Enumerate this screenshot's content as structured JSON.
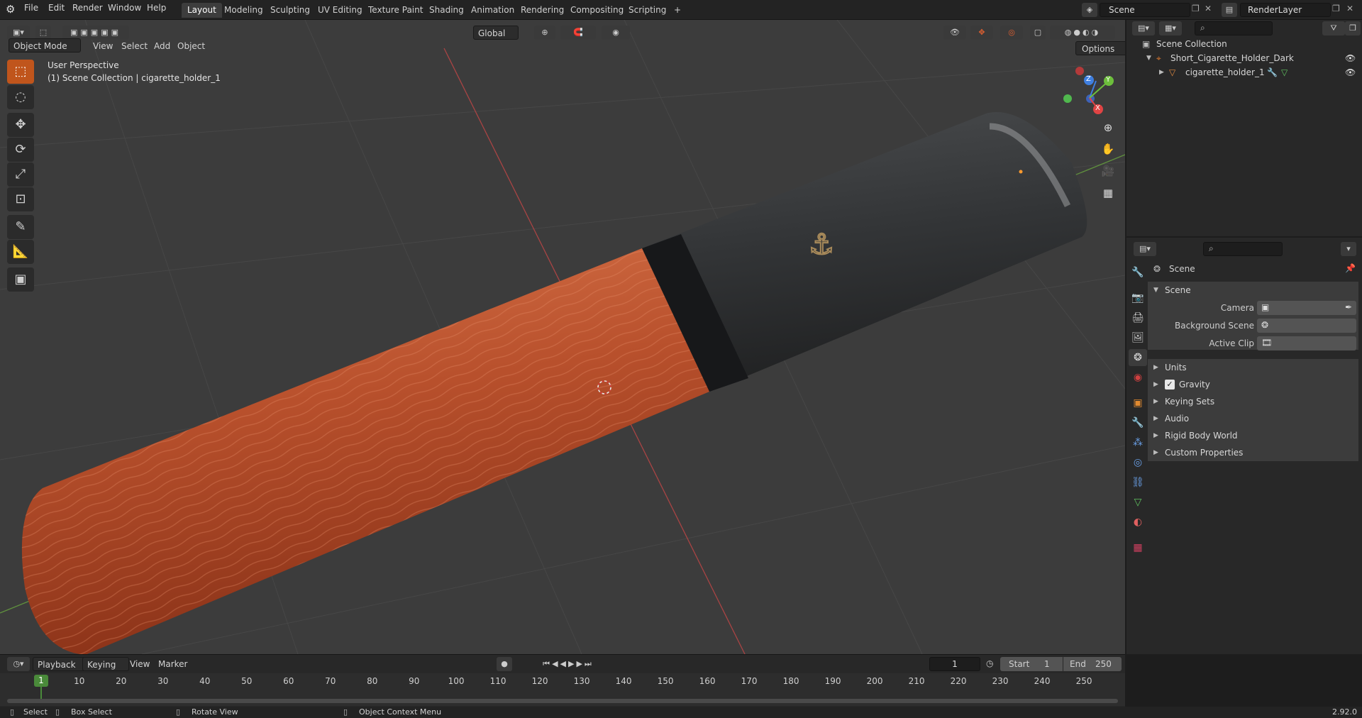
{
  "topbar": {
    "menus": [
      "File",
      "Edit",
      "Render",
      "Window",
      "Help"
    ],
    "workspaces": [
      "Layout",
      "Modeling",
      "Sculpting",
      "UV Editing",
      "Texture Paint",
      "Shading",
      "Animation",
      "Rendering",
      "Compositing",
      "Scripting"
    ],
    "active_workspace": "Layout",
    "add_tab": "+",
    "scene_name": "Scene",
    "view_layer": "RenderLayer"
  },
  "viewport": {
    "mode": "Object Mode",
    "menus": [
      "View",
      "Select",
      "Add",
      "Object"
    ],
    "transform_orientation": "Global",
    "options_label": "Options",
    "overlay_title": "User Perspective",
    "overlay_subtitle": "(1) Scene Collection | cigarette_holder_1",
    "gizmo_axes": {
      "x": "X",
      "y": "Y",
      "z": "Z"
    },
    "colors": {
      "accent": "#c0551c",
      "wood": "#b8502c",
      "mouthpiece": "#2e3032"
    }
  },
  "outliner": {
    "root": "Scene Collection",
    "collection": "Short_Cigarette_Holder_Dark",
    "object": "cigarette_holder_1"
  },
  "properties": {
    "context": "Scene",
    "panel": "Scene",
    "camera_label": "Camera",
    "background_label": "Background Scene",
    "clip_label": "Active Clip",
    "subpanels": [
      "Units",
      "Gravity",
      "Keying Sets",
      "Audio",
      "Rigid Body World",
      "Custom Properties"
    ],
    "gravity_checked": true
  },
  "timeline": {
    "menus": [
      "Playback",
      "Keying",
      "View",
      "Marker"
    ],
    "current_frame": "1",
    "start_label": "Start",
    "start": "1",
    "end_label": "End",
    "end": "250",
    "ticks": [
      "10",
      "20",
      "30",
      "40",
      "50",
      "60",
      "70",
      "80",
      "90",
      "100",
      "110",
      "120",
      "130",
      "140",
      "150",
      "160",
      "170",
      "180",
      "190",
      "200",
      "210",
      "220",
      "230",
      "240",
      "250"
    ],
    "playhead": "1"
  },
  "statusbar": {
    "select": "Select",
    "box_select": "Box Select",
    "rotate": "Rotate View",
    "context_menu": "Object Context Menu",
    "version": "2.92.0"
  }
}
